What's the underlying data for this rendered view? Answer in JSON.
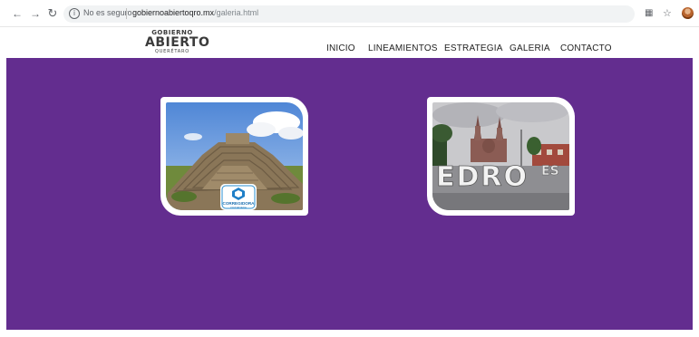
{
  "browser": {
    "back_icon": "back-arrow-icon",
    "forward_icon": "forward-arrow-icon",
    "reload_icon": "reload-icon",
    "security_label": "No es seguro",
    "url_domain": "gobiernoabiertoqro.mx",
    "url_path": "/galeria.html",
    "translate_icon": "translate-icon",
    "bookmark_icon": "star-icon",
    "profile_icon": "avatar"
  },
  "site": {
    "logo": {
      "top": "GOBIERNO",
      "main": "ABIERTO",
      "sub": "QUERÉTARO"
    },
    "menu": [
      "INICIO",
      "LINEAMIENTOS",
      "ESTRATEGIA",
      "GALERIA",
      "CONTACTO"
    ]
  },
  "gallery": {
    "background": "#632d8f",
    "items": [
      {
        "image": "pyramid-photo",
        "badge_top": "CORREGIDORA",
        "badge_bottom": "CIUDADANA"
      },
      {
        "image": "plaza-letters-photo",
        "letters": "EDRO",
        "letters_right": "ES"
      }
    ]
  }
}
